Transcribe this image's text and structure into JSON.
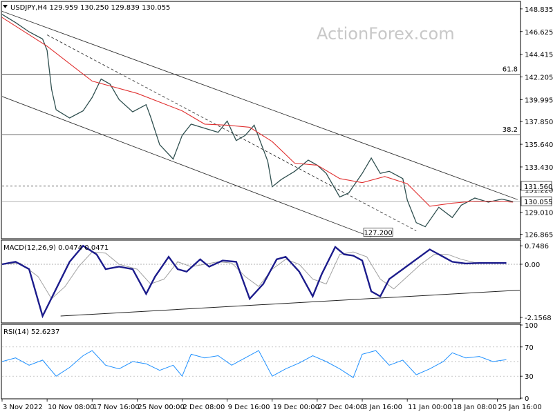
{
  "chart_data": [
    {
      "type": "line",
      "panel": "price",
      "header": "USDJPY,H4  129.959 130.250 129.839 130.055",
      "watermark": "ActionForex.com",
      "ylim": [
        126.5,
        149.5
      ],
      "ytick_labels": [
        "148.835",
        "146.625",
        "144.415",
        "142.205",
        "139.995",
        "137.850",
        "135.640",
        "133.430",
        "131.220",
        "129.010",
        "126.865"
      ],
      "ytick_values": [
        148.835,
        146.625,
        144.415,
        142.205,
        139.995,
        137.85,
        135.64,
        133.43,
        131.22,
        129.01,
        126.865
      ],
      "price_label": "130.055",
      "price_value": 130.055,
      "hline_label": "131.560",
      "hline_value": 131.56,
      "fib_levels": [
        {
          "label": "61.8",
          "value": 142.46
        },
        {
          "label": "38.2",
          "value": 136.58
        }
      ],
      "low_annotation": "127.200",
      "low_value": 127.2,
      "x_labels": [
        "3 Nov 2022",
        "10 Nov 08:00",
        "17 Nov 16:00",
        "25 Nov 00:00",
        "2 Dec 08:00",
        "9 Dec 16:00",
        "19 Dec 00:00",
        "27 Dec 04:00",
        "3 Jan 16:00",
        "11 Jan 00:00",
        "18 Jan 08:00",
        "25 Jan 16:00"
      ],
      "x_positions": [
        0,
        1,
        2,
        3,
        4,
        5,
        6,
        7,
        8,
        9,
        10,
        11
      ],
      "x_max": 11.5,
      "series": [
        {
          "color": "#2f4f4f",
          "x": [
            0.0,
            0.3,
            0.6,
            0.9,
            1.0,
            1.1,
            1.2,
            1.5,
            1.8,
            2.0,
            2.2,
            2.4,
            2.6,
            2.9,
            3.2,
            3.3,
            3.5,
            3.8,
            4.0,
            4.2,
            4.5,
            4.8,
            5.0,
            5.2,
            5.4,
            5.6,
            5.9,
            6.0,
            6.2,
            6.5,
            6.8,
            7.0,
            7.2,
            7.5,
            7.7,
            8.0,
            8.2,
            8.4,
            8.6,
            8.9,
            9.0,
            9.2,
            9.4,
            9.7,
            10.0,
            10.2,
            10.5,
            10.8,
            11.1,
            11.3,
            11.35
          ],
          "values": [
            148.3,
            147.5,
            146.6,
            145.9,
            144.8,
            141.0,
            139.0,
            138.2,
            138.9,
            140.2,
            142.0,
            141.5,
            140.0,
            138.8,
            139.5,
            138.3,
            135.6,
            134.2,
            136.5,
            137.6,
            137.2,
            136.8,
            137.9,
            136.0,
            136.5,
            137.5,
            134.0,
            131.5,
            132.2,
            133.0,
            134.1,
            133.6,
            132.8,
            130.5,
            130.9,
            132.8,
            134.3,
            132.8,
            133.0,
            132.3,
            130.2,
            128.0,
            127.6,
            129.5,
            128.5,
            129.7,
            130.4,
            130.0,
            130.3,
            130.1,
            130.05
          ]
        },
        {
          "color": "#e03030",
          "x": [
            0.0,
            1.0,
            2.0,
            3.0,
            4.0,
            4.5,
            5.0,
            5.5,
            6.0,
            6.5,
            7.0,
            7.5,
            8.0,
            8.5,
            9.0,
            9.5,
            10.0,
            10.5,
            11.0,
            11.35
          ],
          "values": [
            148.0,
            145.2,
            141.8,
            140.6,
            138.9,
            137.6,
            137.5,
            137.3,
            135.9,
            133.8,
            133.6,
            132.3,
            131.9,
            132.5,
            131.8,
            129.6,
            129.9,
            130.1,
            130.1,
            130.0
          ]
        }
      ],
      "trend_lines": [
        {
          "name": "upper-channel",
          "style": "solid",
          "points": [
            [
              0.0,
              148.6
            ],
            [
              11.45,
              130.25
            ]
          ]
        },
        {
          "name": "lower-channel",
          "style": "solid",
          "points": [
            [
              0.0,
              140.3
            ],
            [
              8.2,
              126.6
            ]
          ]
        },
        {
          "name": "dashed-trend",
          "style": "dashed",
          "points": [
            [
              1.0,
              146.3
            ],
            [
              9.2,
              127.2
            ]
          ]
        }
      ]
    },
    {
      "type": "line",
      "panel": "macd",
      "header": "MACD(12,26,9) 0.0474 0.0471",
      "ylim": [
        -2.35,
        0.95
      ],
      "ytick_labels": [
        "0.7486",
        "0.00",
        "-2.1568"
      ],
      "ytick_values": [
        0.7486,
        0.0,
        -2.1568
      ],
      "current_label": "0.00",
      "zero_line": 0.0,
      "series": [
        {
          "name": "MACD",
          "color": "#1c1c8c",
          "x": [
            0.0,
            0.3,
            0.6,
            0.9,
            1.2,
            1.5,
            1.8,
            2.1,
            2.3,
            2.6,
            2.9,
            3.2,
            3.4,
            3.7,
            3.9,
            4.1,
            4.4,
            4.6,
            4.9,
            5.2,
            5.5,
            5.8,
            6.1,
            6.3,
            6.6,
            6.9,
            7.1,
            7.4,
            7.6,
            7.8,
            8.0,
            8.2,
            8.4,
            8.6,
            8.9,
            9.2,
            9.5,
            9.8,
            10.0,
            10.3,
            10.6,
            10.9,
            11.2
          ],
          "values": [
            0.0,
            0.1,
            -0.2,
            -2.1,
            -1.0,
            0.1,
            0.75,
            0.4,
            -0.2,
            -0.1,
            -0.2,
            -1.2,
            -0.5,
            0.3,
            -0.2,
            -0.3,
            0.2,
            -0.1,
            0.15,
            0.1,
            -1.4,
            -0.8,
            0.2,
            0.3,
            -0.3,
            -1.3,
            -0.4,
            0.7,
            0.4,
            0.35,
            0.15,
            -1.1,
            -1.3,
            -0.6,
            -0.2,
            0.2,
            0.6,
            0.3,
            0.1,
            0.03,
            0.05,
            0.05,
            0.05
          ]
        },
        {
          "name": "Signal",
          "color": "#a0a0a0",
          "x": [
            0.0,
            0.4,
            0.8,
            1.1,
            1.4,
            1.7,
            2.0,
            2.3,
            2.6,
            3.0,
            3.3,
            3.6,
            3.9,
            4.2,
            4.5,
            4.8,
            5.1,
            5.4,
            5.7,
            6.0,
            6.3,
            6.6,
            6.9,
            7.2,
            7.5,
            7.8,
            8.1,
            8.4,
            8.7,
            9.0,
            9.3,
            9.6,
            9.9,
            10.2,
            10.5,
            10.8,
            11.2
          ],
          "values": [
            0.0,
            0.05,
            -0.5,
            -1.4,
            -0.9,
            -0.1,
            0.5,
            0.45,
            0.0,
            -0.2,
            -0.8,
            -0.6,
            0.1,
            -0.1,
            0.0,
            0.1,
            0.05,
            -0.5,
            -0.9,
            -0.2,
            0.2,
            0.0,
            -0.6,
            -0.8,
            0.4,
            0.5,
            0.3,
            -0.6,
            -1.0,
            -0.5,
            0.0,
            0.4,
            0.4,
            0.2,
            0.07,
            0.05,
            0.05
          ]
        }
      ],
      "trend_lines": [
        {
          "name": "macd-support-line",
          "style": "solid",
          "points": [
            [
              1.3,
              -2.1
            ],
            [
              11.5,
              -1.05
            ]
          ]
        }
      ]
    },
    {
      "type": "line",
      "panel": "rsi",
      "header": "RSI(14) 52.6237",
      "ylim": [
        0,
        100
      ],
      "ytick_labels": [
        "100",
        "70",
        "30",
        "0"
      ],
      "ytick_values": [
        100,
        70,
        30,
        0
      ],
      "levels": [
        70,
        50,
        30
      ],
      "series": [
        {
          "name": "RSI",
          "color": "#1e90ff",
          "x": [
            0.0,
            0.3,
            0.6,
            0.9,
            1.2,
            1.5,
            1.8,
            2.0,
            2.3,
            2.6,
            2.9,
            3.2,
            3.5,
            3.8,
            4.0,
            4.2,
            4.5,
            4.8,
            5.1,
            5.4,
            5.7,
            6.0,
            6.3,
            6.6,
            6.9,
            7.2,
            7.5,
            7.8,
            8.0,
            8.3,
            8.6,
            8.9,
            9.2,
            9.5,
            9.8,
            10.0,
            10.3,
            10.6,
            10.9,
            11.2
          ],
          "values": [
            50,
            55,
            45,
            52,
            30,
            42,
            58,
            65,
            45,
            40,
            50,
            47,
            38,
            45,
            30,
            60,
            55,
            58,
            45,
            55,
            65,
            30,
            40,
            48,
            58,
            50,
            40,
            28,
            60,
            65,
            45,
            52,
            32,
            40,
            50,
            62,
            55,
            57,
            50,
            52.6
          ]
        }
      ]
    }
  ]
}
